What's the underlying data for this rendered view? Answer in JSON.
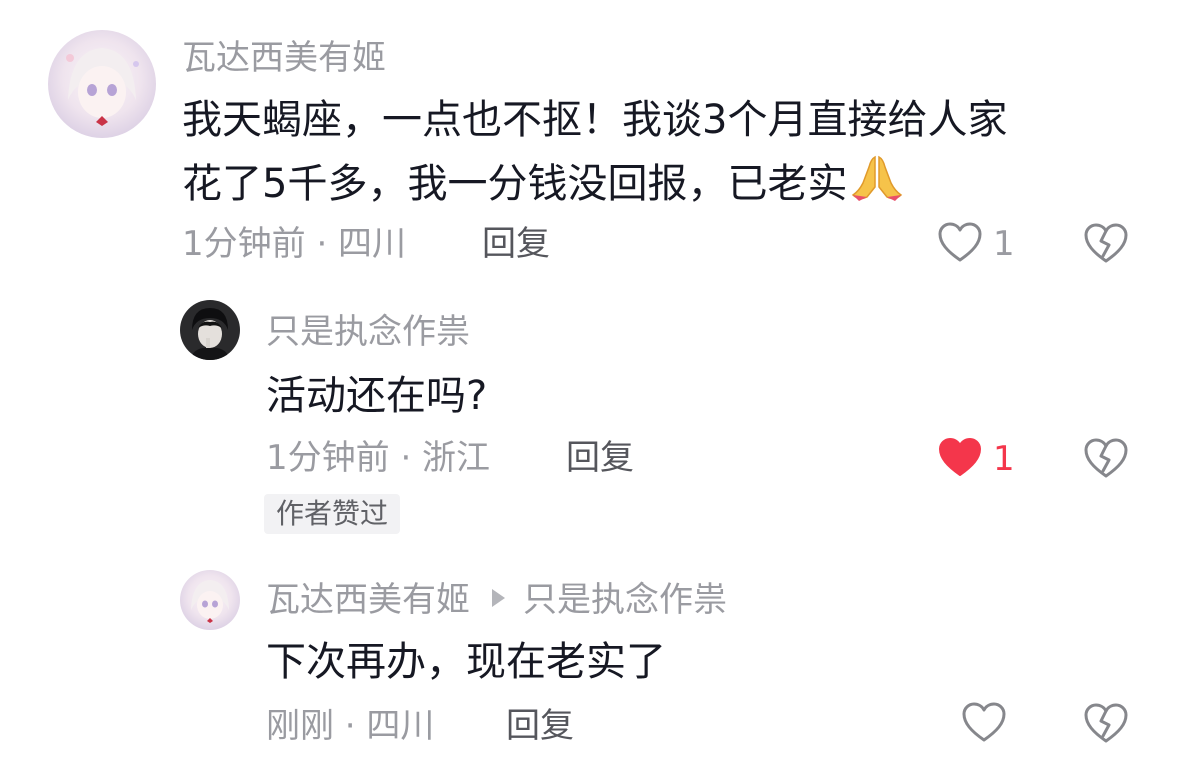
{
  "comments": [
    {
      "username": "瓦达西美有姬",
      "text_line1": "我天蝎座，一点也不抠！我谈3个月直接给人家",
      "text_line2": "花了5千多，我一分钱没回报，已老实",
      "emoji_icon": "folded-hands-emoji",
      "meta": "1分钟前 · 四川",
      "reply_label": "回复",
      "like_count": "1",
      "liked": false
    },
    {
      "username": "只是执念作祟",
      "text": "活动还在吗?",
      "meta": "1分钟前 · 浙江",
      "reply_label": "回复",
      "like_count": "1",
      "liked": true,
      "badge": "作者赞过"
    },
    {
      "username": "瓦达西美有姬",
      "reply_to": "只是执念作祟",
      "text": "下次再办，现在老实了",
      "meta": "刚刚 · 四川",
      "reply_label": "回复",
      "like_count": "",
      "liked": false
    }
  ],
  "colors": {
    "text_primary": "#161823",
    "text_secondary": "#9a9ba1",
    "reply_button": "#55565c",
    "like_active": "#f4364b",
    "badge_bg": "#f2f2f4"
  }
}
